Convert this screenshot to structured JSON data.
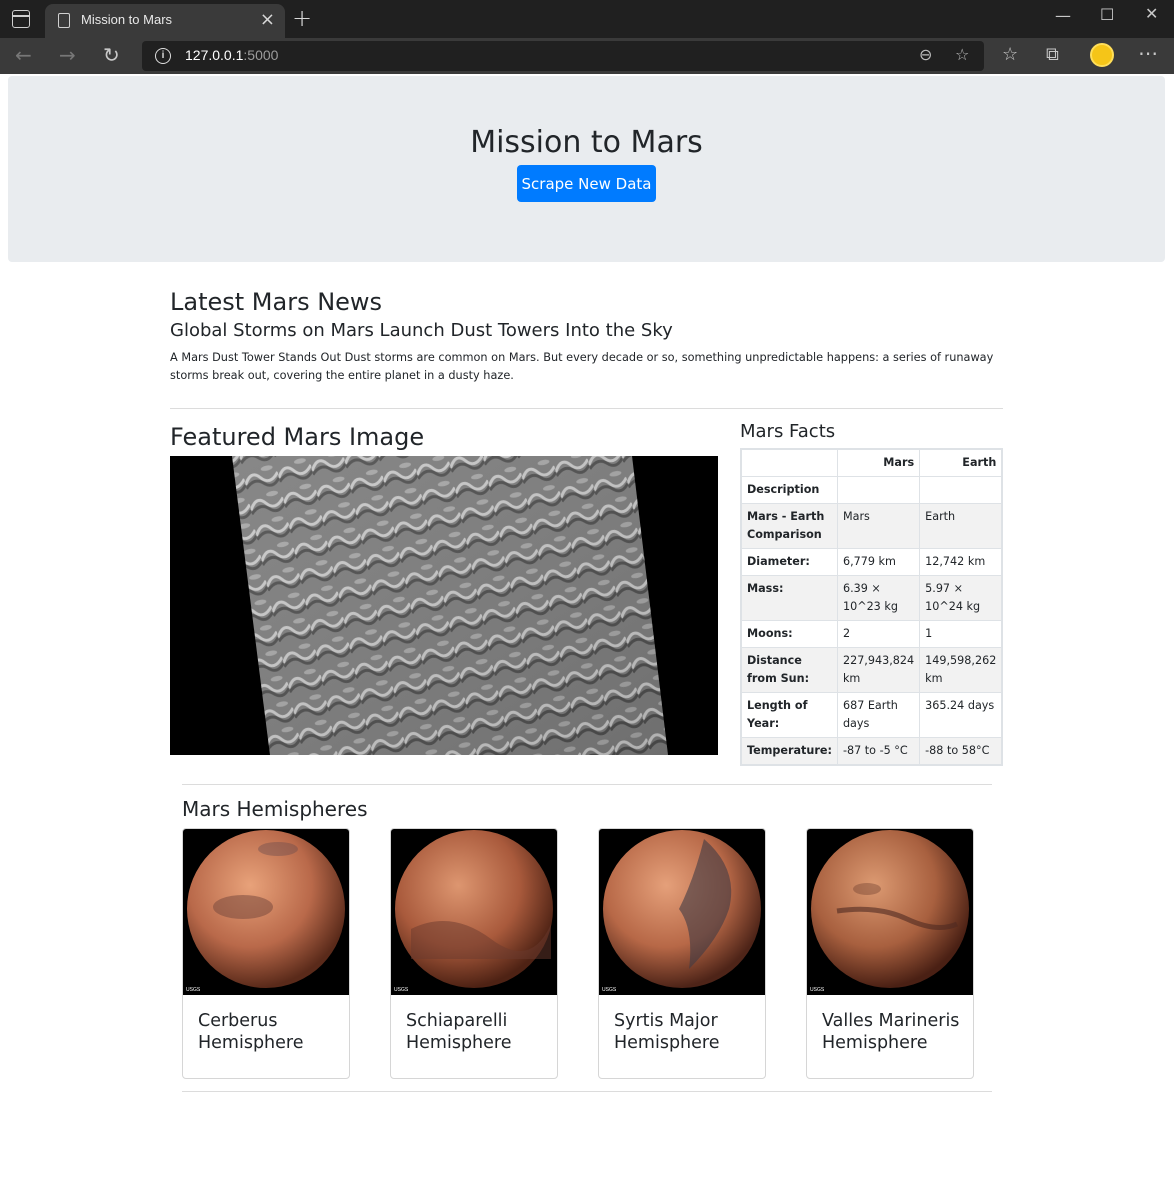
{
  "browser": {
    "tab_title": "Mission to Mars",
    "url_host": "127.0.0.1",
    "url_port": ":5000"
  },
  "header": {
    "title": "Mission to Mars",
    "scrape_button": "Scrape New Data"
  },
  "news": {
    "section_title": "Latest Mars News",
    "headline": "Global Storms on Mars Launch Dust Towers Into the Sky",
    "paragraph": "A Mars Dust Tower Stands Out Dust storms are common on Mars. But every decade or so, something unpredictable happens: a series of runaway storms break out, covering the entire planet in a dusty haze."
  },
  "featured": {
    "section_title": "Featured Mars Image"
  },
  "facts": {
    "section_title": "Mars Facts",
    "col_mars": "Mars",
    "col_earth": "Earth",
    "rows": [
      {
        "label": "Description",
        "mars": "",
        "earth": ""
      },
      {
        "label": "Mars - Earth Comparison",
        "mars": "Mars",
        "earth": "Earth"
      },
      {
        "label": "Diameter:",
        "mars": "6,779 km",
        "earth": "12,742 km"
      },
      {
        "label": "Mass:",
        "mars": "6.39 × 10^23 kg",
        "earth": "5.97 × 10^24 kg"
      },
      {
        "label": "Moons:",
        "mars": "2",
        "earth": "1"
      },
      {
        "label": "Distance from Sun:",
        "mars": "227,943,824 km",
        "earth": "149,598,262 km"
      },
      {
        "label": "Length of Year:",
        "mars": "687 Earth days",
        "earth": "365.24 days"
      },
      {
        "label": "Temperature:",
        "mars": "-87 to -5 °C",
        "earth": "-88 to 58°C"
      }
    ]
  },
  "hemispheres": {
    "section_title": "Mars Hemispheres",
    "items": [
      {
        "name": "Cerberus Hemisphere",
        "badge": "USGS"
      },
      {
        "name": "Schiaparelli Hemisphere",
        "badge": "USGS"
      },
      {
        "name": "Syrtis Major Hemisphere",
        "badge": "USGS"
      },
      {
        "name": "Valles Marineris Hemisphere",
        "badge": "USGS"
      }
    ]
  }
}
